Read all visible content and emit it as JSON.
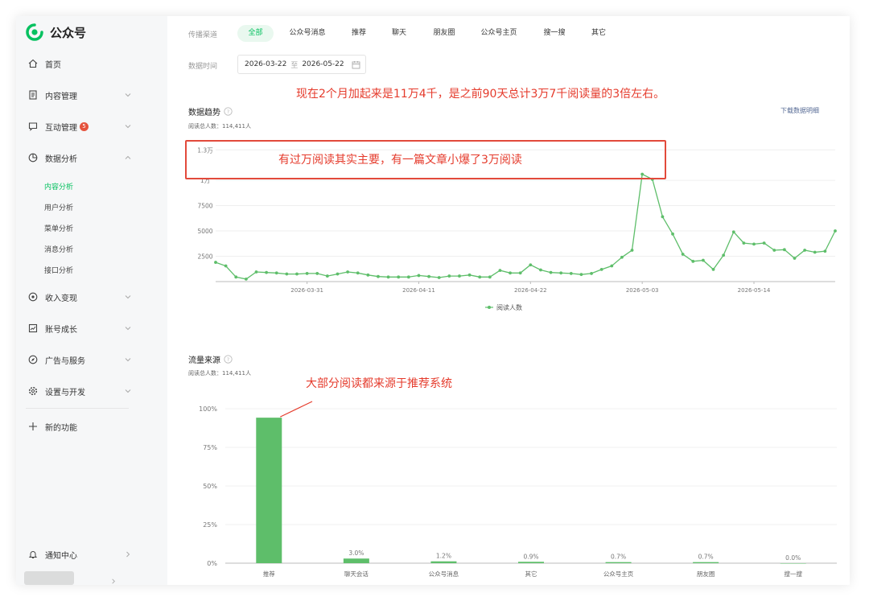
{
  "app": {
    "name": "公众号"
  },
  "sidebar": {
    "items": [
      {
        "label": "首页",
        "icon": "home-icon"
      },
      {
        "label": "内容管理",
        "icon": "document-icon"
      },
      {
        "label": "互动管理",
        "icon": "message-icon",
        "badge": "5"
      },
      {
        "label": "数据分析",
        "icon": "pie-chart-icon"
      },
      {
        "label": "收入变现",
        "icon": "coin-icon"
      },
      {
        "label": "账号成长",
        "icon": "growth-chart-icon"
      },
      {
        "label": "广告与服务",
        "icon": "compass-icon"
      },
      {
        "label": "设置与开发",
        "icon": "gear-icon"
      },
      {
        "label": "新的功能",
        "icon": "plus-icon"
      }
    ],
    "sub_items": [
      "内容分析",
      "用户分析",
      "菜单分析",
      "消息分析",
      "接口分析"
    ],
    "active_sub": "内容分析",
    "footer": {
      "notifications": "通知中心"
    }
  },
  "filters": {
    "channel_label": "传播渠道",
    "tabs": [
      "全部",
      "公众号消息",
      "推荐",
      "聊天",
      "朋友圈",
      "公众号主页",
      "搜一搜",
      "其它"
    ],
    "active_tab": "全部",
    "date_label": "数据时间",
    "date_start": "2026-03-22",
    "date_sep": "至",
    "date_end": "2026-05-22"
  },
  "annotations": {
    "top": "现在2个月加起来是11万4千，是之前90天总计3万7千阅读量的3倍左右。",
    "box": "有过万阅读其实主要，有一篇文章小爆了3万阅读",
    "bar": "大部分阅读都来源于推荐系统"
  },
  "trend": {
    "title": "数据趋势",
    "subtitle": "阅读总人数：114,411人",
    "download": "下载数据明细"
  },
  "source": {
    "title": "流量来源",
    "subtitle": "阅读总人数：114,411人"
  },
  "colors": {
    "accent": "#07c160",
    "chart_green": "#5ebe6a",
    "annotation": "#e53b2c"
  },
  "chart_data": [
    {
      "type": "line",
      "y_ticks": [
        "1.3万",
        "1万",
        "7500",
        "5000",
        "2500"
      ],
      "x_tick_labels": [
        "2026-03-31",
        "2026-04-11",
        "2026-04-22",
        "2026-05-03",
        "2026-05-14"
      ],
      "x_tick_index": [
        9,
        20,
        31,
        42,
        53
      ],
      "ylim": [
        0,
        13500
      ],
      "grid": true,
      "legend": "bottom",
      "series": [
        {
          "name": "阅读人数",
          "values": [
            1900,
            1550,
            450,
            250,
            950,
            900,
            850,
            750,
            750,
            800,
            800,
            550,
            750,
            950,
            850,
            650,
            500,
            450,
            450,
            450,
            600,
            500,
            400,
            550,
            550,
            650,
            450,
            450,
            1100,
            850,
            850,
            1650,
            1150,
            900,
            850,
            800,
            700,
            800,
            1200,
            1550,
            2400,
            3100,
            10600,
            10100,
            6400,
            4700,
            2700,
            2000,
            2100,
            1200,
            2600,
            4900,
            3800,
            3700,
            3800,
            3100,
            3150,
            2300,
            3100,
            2900,
            3000,
            5000
          ]
        }
      ]
    },
    {
      "type": "bar",
      "y_ticks": [
        "100%",
        "75%",
        "50%",
        "25%",
        "0%"
      ],
      "ylim": [
        0,
        100
      ],
      "categories": [
        "推荐",
        "聊天会话",
        "公众号消息",
        "其它",
        "公众号主页",
        "朋友圈",
        "搜一搜"
      ],
      "values": [
        94.2,
        3.0,
        1.2,
        0.9,
        0.7,
        0.7,
        0.0
      ],
      "value_labels": [
        "",
        "3.0%",
        "1.2%",
        "0.9%",
        "0.7%",
        "0.7%",
        "0.0%"
      ]
    }
  ]
}
